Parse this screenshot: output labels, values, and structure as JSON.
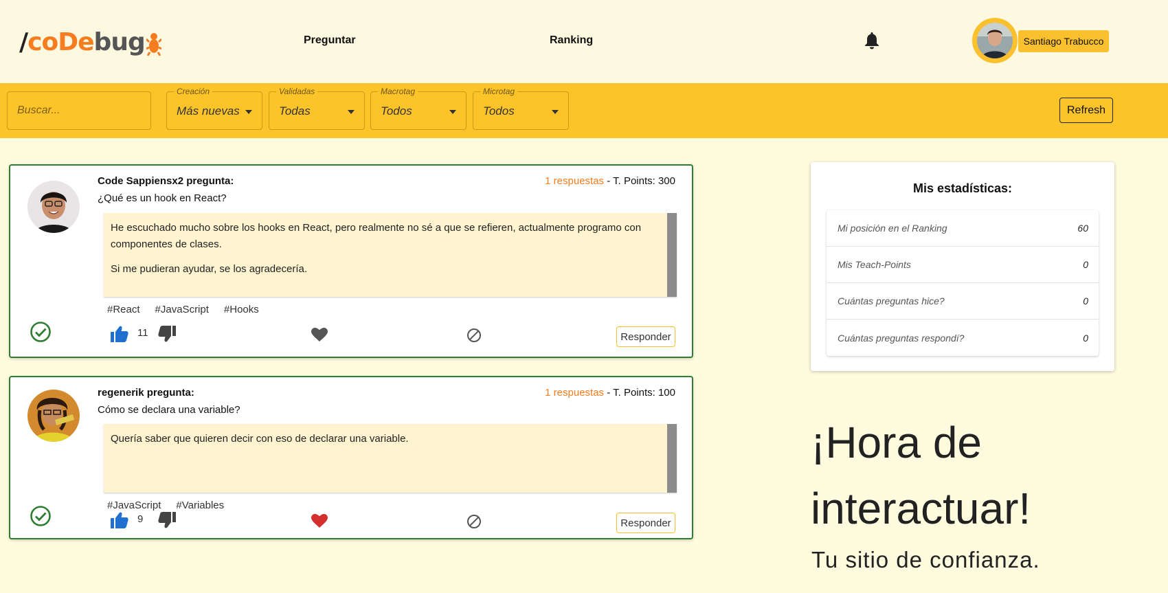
{
  "header": {
    "logo": {
      "slash": "/",
      "co": "co",
      "de": "De",
      "bug": "bug"
    },
    "nav": {
      "ask": "Preguntar",
      "ranking": "Ranking"
    },
    "user": {
      "name": "Santiago Trabucco"
    }
  },
  "filters": {
    "search_placeholder": "Buscar...",
    "creation": {
      "label": "Creación",
      "value": "Más nuevas"
    },
    "validated": {
      "label": "Validadas",
      "value": "Todas"
    },
    "macrotag": {
      "label": "Macrotag",
      "value": "Todos"
    },
    "microtag": {
      "label": "Microtag",
      "value": "Todos"
    },
    "refresh_label": "Refresh"
  },
  "questions": [
    {
      "author": "Code Sappiensx2 pregunta:",
      "answers": "1 respuestas",
      "points": " - T. Points: 300",
      "title": "¿Qué es un hook en React?",
      "body": [
        "He escuchado mucho sobre los hooks en React, pero realmente no sé a que se refieren, actualmente programo con componentes de clases.",
        "Si me pudieran ayudar, se los agradecería."
      ],
      "tags": [
        "#React",
        "#JavaScript",
        "#Hooks"
      ],
      "votes": "11",
      "favorited": false,
      "reply_label": "Responder"
    },
    {
      "author": "regenerik pregunta:",
      "answers": "1 respuestas",
      "points": " - T. Points: 100",
      "title": "Cómo se declara una variable?",
      "body": [
        "Quería saber que quieren decir con eso de declarar una variable."
      ],
      "tags": [
        "#JavaScript",
        "#Variables"
      ],
      "votes": "9",
      "favorited": true,
      "reply_label": "Responder"
    }
  ],
  "stats": {
    "title": "Mis estadísticas:",
    "rows": [
      {
        "label": "Mi posición en el Ranking",
        "value": "60"
      },
      {
        "label": "Mis Teach-Points",
        "value": "0"
      },
      {
        "label": "Cuántas preguntas hice?",
        "value": "0"
      },
      {
        "label": "Cuántas preguntas respondí?",
        "value": "0"
      }
    ]
  },
  "hero": {
    "title": "¡Hora de interactuar!",
    "subtitle": "Tu sitio de confianza."
  },
  "colors": {
    "accent": "#fdc42a",
    "brand_orange": "#f57c1f",
    "validated_green": "#2e7d32",
    "like_blue": "#1e6fd0",
    "heart_red": "#d32f2f"
  }
}
